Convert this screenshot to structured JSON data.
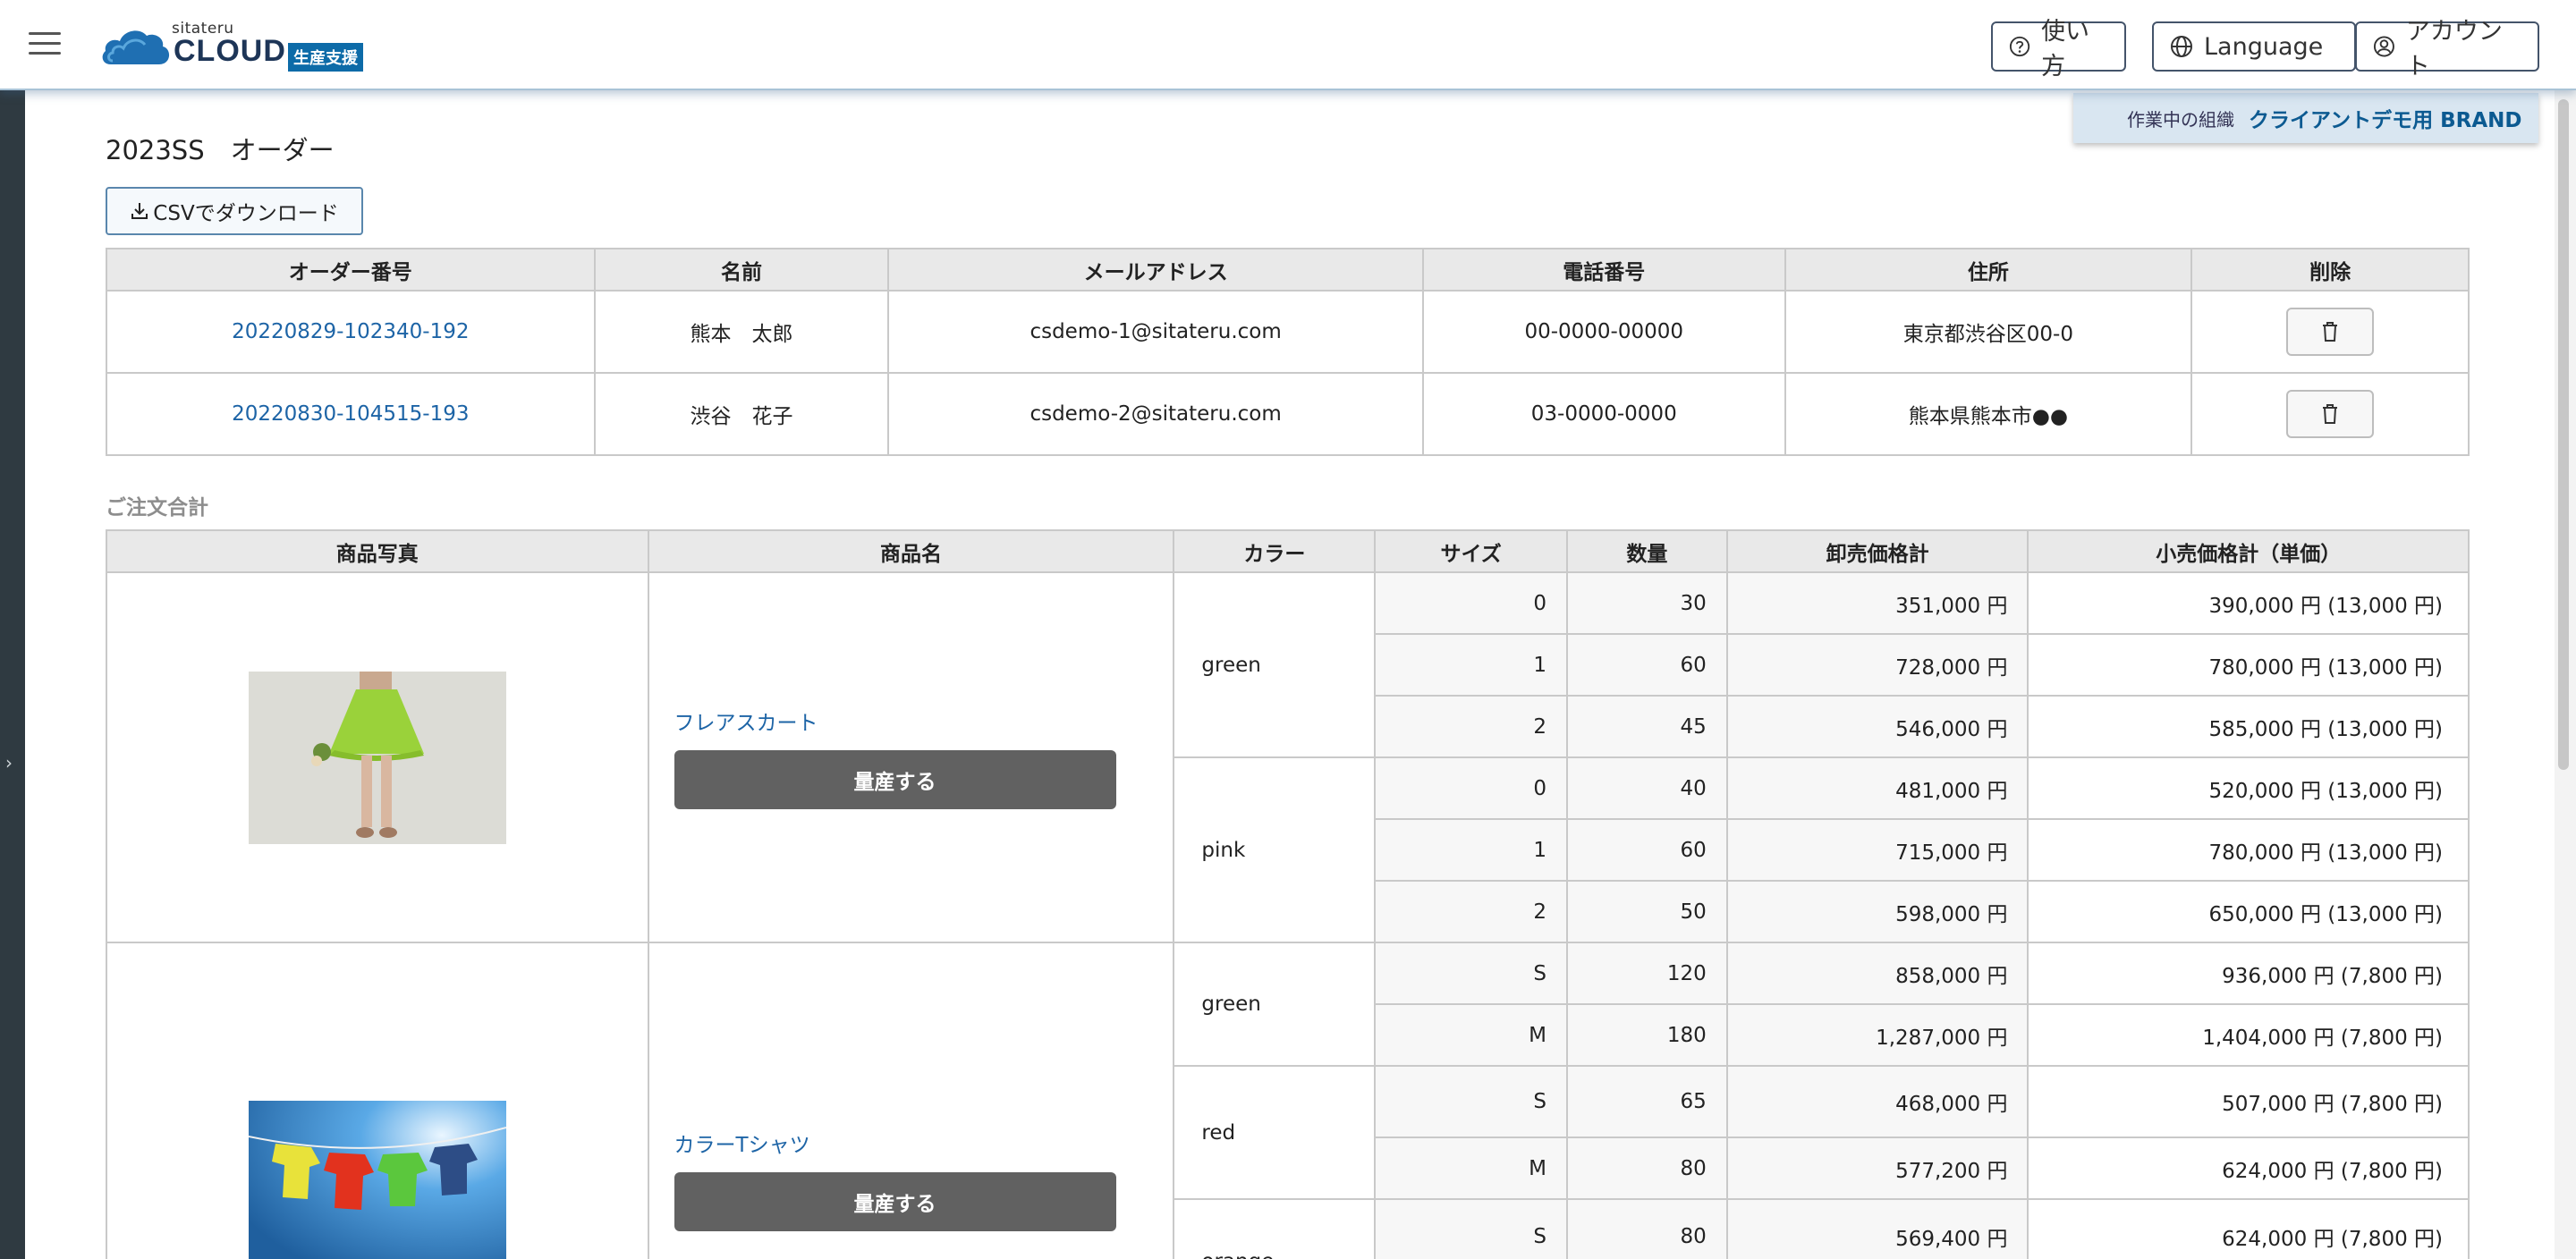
{
  "header": {
    "logo_sub": "sitateru",
    "logo_main": "CLOUD",
    "logo_tag": "生産支援",
    "help_label": "使い方",
    "language_label": "Language",
    "account_label": "アカウント"
  },
  "org": {
    "label": "作業中の組織",
    "value": "クライアントデモ用 BRAND"
  },
  "page": {
    "title": "2023SS　オーダー",
    "csv_label": "CSVでダウンロード"
  },
  "orders": {
    "headers": [
      "オーダー番号",
      "名前",
      "メールアドレス",
      "電話番号",
      "住所",
      "削除"
    ],
    "rows": [
      {
        "order_no": "20220829-102340-192",
        "name": "熊本　太郎",
        "email": "csdemo-1@sitateru.com",
        "phone": "00-0000-00000",
        "address": "東京都渋谷区00-0"
      },
      {
        "order_no": "20220830-104515-193",
        "name": "渋谷　花子",
        "email": "csdemo-2@sitateru.com",
        "phone": "03-0000-0000",
        "address": "熊本県熊本市●●"
      }
    ]
  },
  "summary": {
    "heading": "ご注文合計",
    "headers": [
      "商品写真",
      "商品名",
      "カラー",
      "サイズ",
      "数量",
      "卸売価格計",
      "小売価格計（単価）"
    ],
    "mass_label": "量産する",
    "products": [
      {
        "name": "フレアスカート",
        "colors": [
          {
            "color": "green",
            "rows": [
              {
                "size": "0",
                "qty": "30",
                "wholesale": "351,000 円",
                "retail": "390,000 円 (13,000 円)"
              },
              {
                "size": "1",
                "qty": "60",
                "wholesale": "728,000 円",
                "retail": "780,000 円 (13,000 円)"
              },
              {
                "size": "2",
                "qty": "45",
                "wholesale": "546,000 円",
                "retail": "585,000 円 (13,000 円)"
              }
            ]
          },
          {
            "color": "pink",
            "rows": [
              {
                "size": "0",
                "qty": "40",
                "wholesale": "481,000 円",
                "retail": "520,000 円 (13,000 円)"
              },
              {
                "size": "1",
                "qty": "60",
                "wholesale": "715,000 円",
                "retail": "780,000 円 (13,000 円)"
              },
              {
                "size": "2",
                "qty": "50",
                "wholesale": "598,000 円",
                "retail": "650,000 円 (13,000 円)"
              }
            ]
          }
        ]
      },
      {
        "name": "カラーTシャツ",
        "colors": [
          {
            "color": "green",
            "rows": [
              {
                "size": "S",
                "qty": "120",
                "wholesale": "858,000 円",
                "retail": "936,000 円 (7,800 円)"
              },
              {
                "size": "M",
                "qty": "180",
                "wholesale": "1,287,000 円",
                "retail": "1,404,000 円 (7,800 円)"
              }
            ]
          },
          {
            "color": "red",
            "rows": [
              {
                "size": "S",
                "qty": "65",
                "wholesale": "468,000 円",
                "retail": "507,000 円 (7,800 円)"
              },
              {
                "size": "M",
                "qty": "80",
                "wholesale": "577,200 円",
                "retail": "624,000 円 (7,800 円)"
              }
            ]
          },
          {
            "color": "orange",
            "rows": [
              {
                "size": "S",
                "qty": "80",
                "wholesale": "569,400 円",
                "retail": "624,000 円 (7,800 円)"
              }
            ]
          }
        ]
      }
    ]
  }
}
